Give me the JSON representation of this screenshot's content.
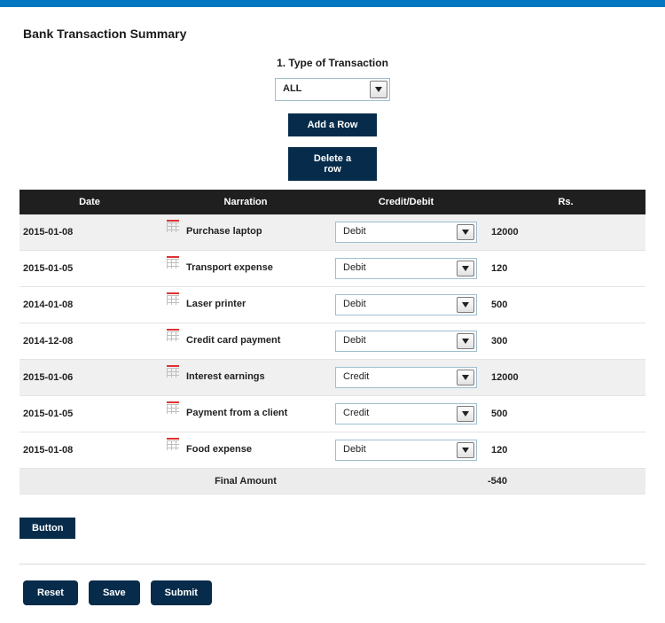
{
  "header": {
    "title": "Bank Transaction Summary"
  },
  "filter": {
    "section_label": "1.  Type of Transaction",
    "value": "ALL",
    "add_row_label": "Add a Row",
    "delete_row_label": "Delete a row"
  },
  "columns": {
    "date": "Date",
    "narration": "Narration",
    "cd": "Credit/Debit",
    "amount": "Rs."
  },
  "rows": [
    {
      "date": "2015-01-08",
      "narration": "Purchase laptop",
      "cd": "Debit",
      "amount": "12000"
    },
    {
      "date": "2015-01-05",
      "narration": "Transport expense",
      "cd": "Debit",
      "amount": "120"
    },
    {
      "date": "2014-01-08",
      "narration": "Laser printer",
      "cd": "Debit",
      "amount": "500"
    },
    {
      "date": "2014-12-08",
      "narration": "Credit card payment",
      "cd": "Debit",
      "amount": "300"
    },
    {
      "date": "2015-01-06",
      "narration": "Interest earnings",
      "cd": "Credit",
      "amount": "12000"
    },
    {
      "date": "2015-01-05",
      "narration": "Payment from a client",
      "cd": "Credit",
      "amount": "500"
    },
    {
      "date": "2015-01-08",
      "narration": "Food expense",
      "cd": "Debit",
      "amount": "120"
    }
  ],
  "footer": {
    "final_label": "Final Amount",
    "final_value": "-540",
    "button_label": "Button"
  },
  "actions": {
    "reset": "Reset",
    "save": "Save",
    "submit": "Submit"
  }
}
